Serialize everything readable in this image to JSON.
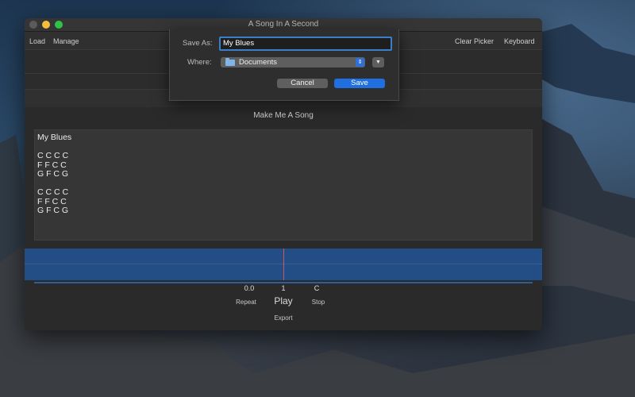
{
  "window": {
    "title": "A Song In A Second"
  },
  "toolbar": {
    "load": "Load",
    "manage": "Manage",
    "clear_picker": "Clear Picker",
    "keyboard": "Keyboard"
  },
  "main": {
    "section_title": "Make Me A Song",
    "song_text": "My Blues\n\nC C C C\nF F C C\nG F C G\n\nC C C C\nF F C C\nG F C G"
  },
  "transport": {
    "time_value": "0.0",
    "position_value": "1",
    "key_value": "C",
    "repeat": "Repeat",
    "play": "Play",
    "stop": "Stop",
    "export": "Export"
  },
  "save_sheet": {
    "save_as_label": "Save As:",
    "filename": "My Blues",
    "where_label": "Where:",
    "where_value": "Documents",
    "cancel": "Cancel",
    "save": "Save"
  },
  "colors": {
    "accent": "#1f6fe0",
    "track": "#234e85",
    "playhead": "#d0556a"
  }
}
